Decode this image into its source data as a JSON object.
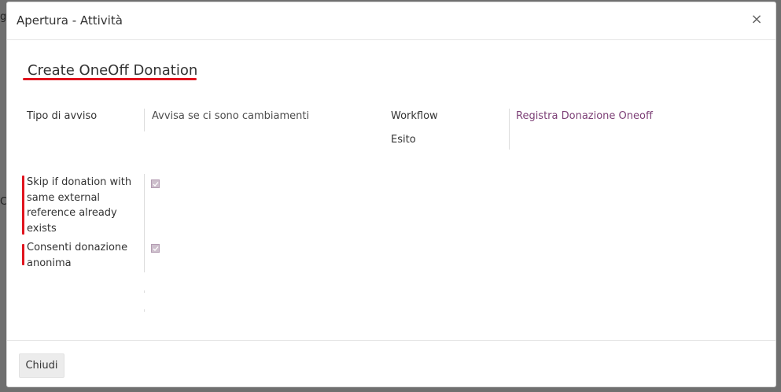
{
  "dialog": {
    "title": "Apertura - Attività",
    "close_symbol": "×"
  },
  "record": {
    "title": "Create OneOff Donation"
  },
  "fields": {
    "tipo_avviso_label": "Tipo di avviso",
    "tipo_avviso_value": "Avvisa se ci sono cambiamenti",
    "workflow_label": "Workflow",
    "workflow_value": "Registra Donazione Oneoff",
    "esito_label": "Esito",
    "skip_label_lines": [
      "Skip if donation with",
      "same external",
      "reference already",
      "exists"
    ],
    "skip_checked": true,
    "anonima_label_lines": [
      "Consenti donazione",
      "anonima"
    ],
    "anonima_checked": true
  },
  "footer": {
    "close_label": "Chiudi"
  },
  "colors": {
    "accent_link": "#7c3f76",
    "highlight_red": "#e0141e",
    "checkbox_fill": "#cdbfcc"
  }
}
